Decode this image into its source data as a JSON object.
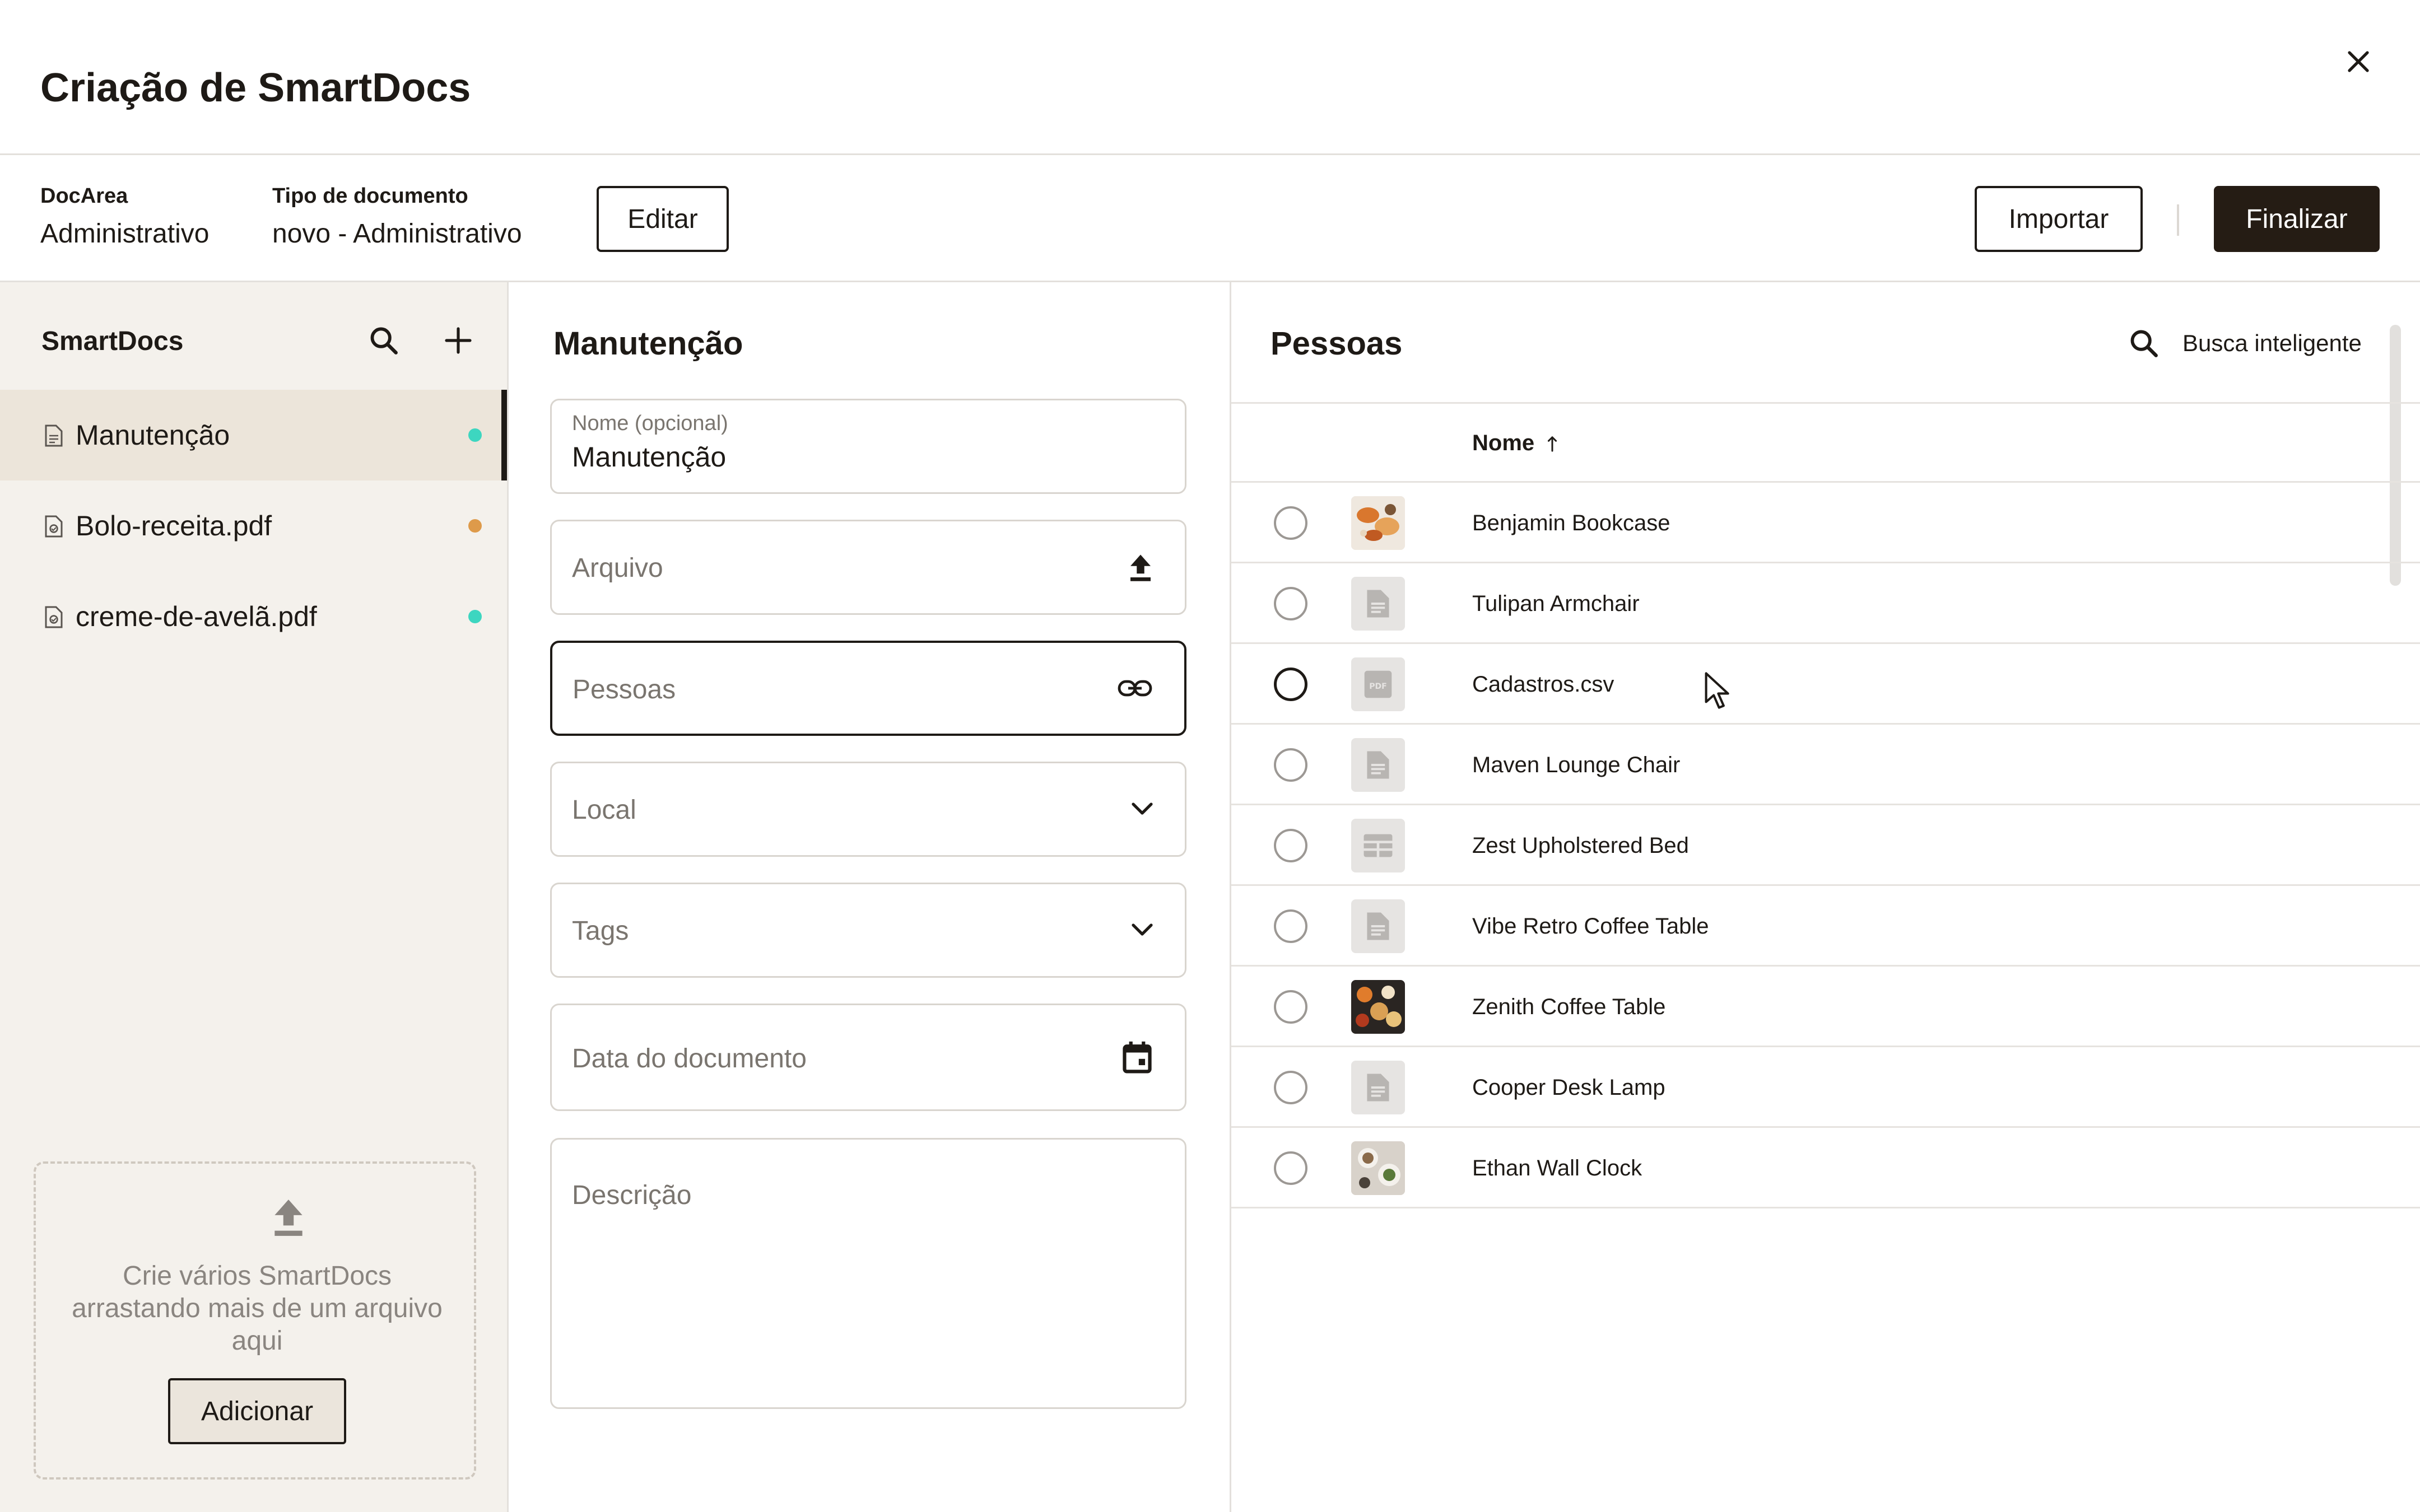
{
  "header": {
    "title": "Criação de SmartDocs"
  },
  "info": {
    "docarea_label": "DocArea",
    "docarea_value": "Administrativo",
    "doctype_label": "Tipo de documento",
    "doctype_value": "novo - Administrativo",
    "edit_label": "Editar",
    "import_label": "Importar",
    "finish_label": "Finalizar"
  },
  "sidebar": {
    "title": "SmartDocs",
    "items": [
      {
        "label": "Manutenção",
        "status_color": "#3dd6c0",
        "active": true
      },
      {
        "label": "Bolo-receita.pdf",
        "status_color": "#de9a4a",
        "active": false
      },
      {
        "label": "creme-de-avelã.pdf",
        "status_color": "#3dd6c0",
        "active": false
      }
    ],
    "dropzone": {
      "text": "Crie vários SmartDocs arrastando mais de um arquivo aqui",
      "button_label": "Adicionar"
    }
  },
  "form": {
    "title": "Manutenção",
    "name_label": "Nome (opcional)",
    "name_value": "Manutenção",
    "file_placeholder": "Arquivo",
    "people_placeholder": "Pessoas",
    "location_placeholder": "Local",
    "tags_placeholder": "Tags",
    "date_placeholder": "Data do documento",
    "description_placeholder": "Descrição"
  },
  "people": {
    "title": "Pessoas",
    "search_label": "Busca inteligente",
    "column_name": "Nome",
    "sort": "ascending",
    "rows": [
      {
        "name": "Benjamin Bookcase",
        "thumb": "image-food-1"
      },
      {
        "name": "Tulipan Armchair",
        "thumb": "doc-icon"
      },
      {
        "name": "Cadastros.csv",
        "thumb": "pdf-icon"
      },
      {
        "name": "Maven Lounge Chair",
        "thumb": "doc-icon"
      },
      {
        "name": "Zest Upholstered Bed",
        "thumb": "table-icon"
      },
      {
        "name": "Vibe Retro Coffee Table",
        "thumb": "doc-icon"
      },
      {
        "name": "Zenith Coffee Table",
        "thumb": "image-food-2"
      },
      {
        "name": "Cooper Desk Lamp",
        "thumb": "doc-icon"
      },
      {
        "name": "Ethan Wall Clock",
        "thumb": "image-food-3"
      }
    ]
  },
  "colors": {
    "primary_dark": "#251c14",
    "sidebar_bg": "#f4f1ec",
    "active_item_bg": "#ece5da",
    "status_teal": "#3dd6c0",
    "status_orange": "#de9a4a"
  }
}
